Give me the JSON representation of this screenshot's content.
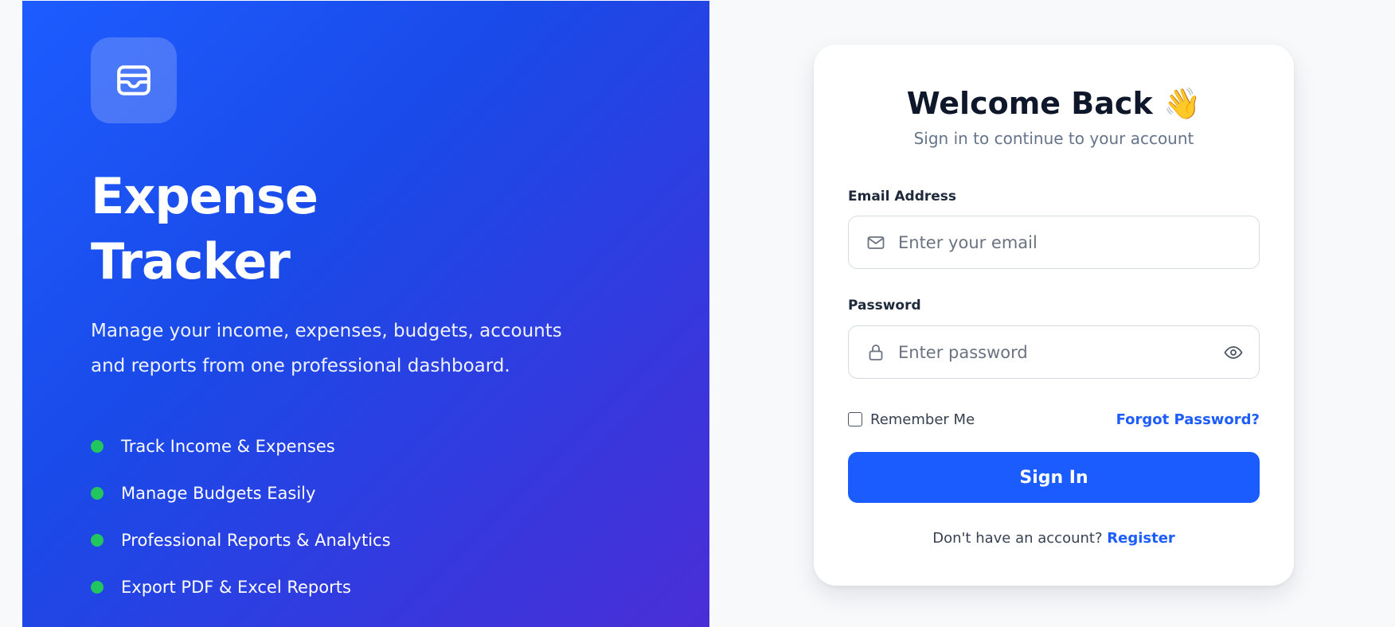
{
  "colors": {
    "brand_blue": "#1a5cff",
    "hero_gradient_start": "#1d5cff",
    "hero_gradient_end": "#4a2ed6",
    "feature_dot": "#22c55e",
    "link": "#1d5cff"
  },
  "hero": {
    "logo_icon": "wallet-icon",
    "title_line1": "Expense",
    "title_line2": "Tracker",
    "description": "Manage your income, expenses, budgets, accounts and reports from one professional dashboard.",
    "features": [
      "Track Income & Expenses",
      "Manage Budgets Easily",
      "Professional Reports & Analytics",
      "Export PDF & Excel Reports"
    ]
  },
  "login": {
    "title": "Welcome Back 👋",
    "subtitle": "Sign in to continue to your account",
    "email_label": "Email Address",
    "email_icon": "mail-icon",
    "email_placeholder": "Enter your email",
    "email_value": "",
    "password_label": "Password",
    "password_icon": "lock-icon",
    "password_placeholder": "Enter password",
    "password_value": "",
    "toggle_icon": "eye-icon",
    "remember_label": "Remember Me",
    "remember_checked": false,
    "forgot_label": "Forgot Password?",
    "signin_label": "Sign In",
    "no_account_text": "Don't have an account?",
    "register_label": "Register"
  }
}
